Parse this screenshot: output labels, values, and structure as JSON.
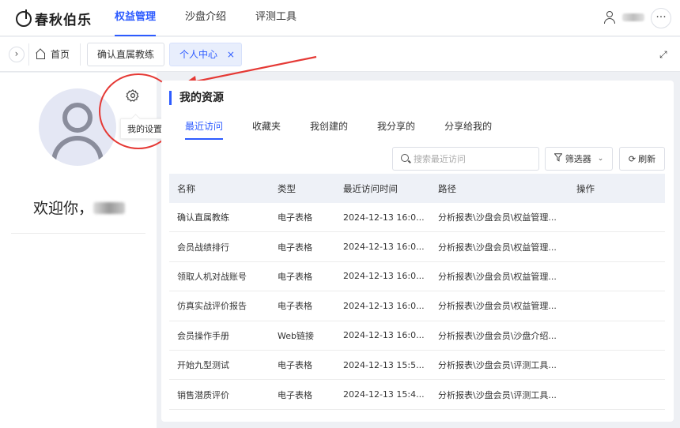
{
  "app": {
    "brand_name": "春秋伯乐",
    "nav": [
      {
        "label": "权益管理",
        "active": true
      },
      {
        "label": "沙盘介绍",
        "active": false
      },
      {
        "label": "评测工具",
        "active": false
      }
    ],
    "more_label": "···"
  },
  "tabbar": {
    "collapse_label": "›",
    "home_label": "首页",
    "tabs": [
      {
        "label": "确认直属教练",
        "active": false
      },
      {
        "label": "个人中心",
        "active": true
      }
    ],
    "close_label": "×",
    "expand_label": "⤢"
  },
  "profile": {
    "settings_tooltip": "我的设置",
    "welcome_text": "欢迎你，"
  },
  "resources": {
    "title": "我的资源",
    "subtabs": [
      {
        "label": "最近访问",
        "active": true
      },
      {
        "label": "收藏夹",
        "active": false
      },
      {
        "label": "我创建的",
        "active": false
      },
      {
        "label": "我分享的",
        "active": false
      },
      {
        "label": "分享给我的",
        "active": false
      }
    ],
    "search_placeholder": "搜索最近访问",
    "filter_label": "筛选器",
    "refresh_label": "刷新",
    "columns": [
      "名称",
      "类型",
      "最近访问时间",
      "路径",
      "操作"
    ],
    "rows": [
      {
        "name": "确认直属教练",
        "type": "电子表格",
        "time": "2024-12-13 16:0...",
        "path": "分析报表\\沙盘会员\\权益管理..."
      },
      {
        "name": "会员战绩排行",
        "type": "电子表格",
        "time": "2024-12-13 16:0...",
        "path": "分析报表\\沙盘会员\\权益管理..."
      },
      {
        "name": "领取人机对战账号",
        "type": "电子表格",
        "time": "2024-12-13 16:0...",
        "path": "分析报表\\沙盘会员\\权益管理..."
      },
      {
        "name": "仿真实战评价报告",
        "type": "电子表格",
        "time": "2024-12-13 16:0...",
        "path": "分析报表\\沙盘会员\\权益管理..."
      },
      {
        "name": "会员操作手册",
        "type": "Web链接",
        "time": "2024-12-13 16:0...",
        "path": "分析报表\\沙盘会员\\沙盘介绍..."
      },
      {
        "name": "开始九型测试",
        "type": "电子表格",
        "time": "2024-12-13 15:5...",
        "path": "分析报表\\沙盘会员\\评测工具..."
      },
      {
        "name": "销售潜质评价",
        "type": "电子表格",
        "time": "2024-12-13 15:4...",
        "path": "分析报表\\沙盘会员\\评测工具..."
      }
    ]
  },
  "colors": {
    "accent": "#2d5bff",
    "annotation": "#e53935",
    "table_header_bg": "#eef1f7"
  }
}
